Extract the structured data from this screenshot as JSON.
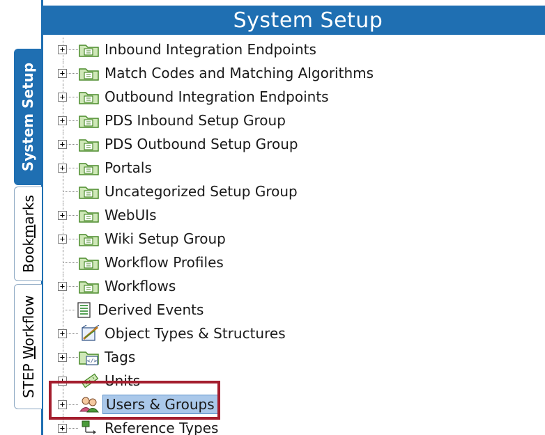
{
  "title": "System Setup",
  "tabs": [
    {
      "label_pre": "System Setup",
      "label_ul": "",
      "label_post": "",
      "active": true
    },
    {
      "label_pre": "Book",
      "label_ul": "m",
      "label_post": "arks",
      "active": false
    },
    {
      "label_pre": "STEP ",
      "label_ul": "W",
      "label_post": "orkflow",
      "active": false
    }
  ],
  "tree": {
    "items": [
      {
        "label": "Inbound Integration Endpoints",
        "icon": "folder-icon",
        "expandable": true
      },
      {
        "label": "Match Codes and Matching Algorithms",
        "icon": "folder-icon",
        "expandable": true
      },
      {
        "label": "Outbound Integration Endpoints",
        "icon": "folder-icon",
        "expandable": true
      },
      {
        "label": "PDS Inbound Setup Group",
        "icon": "folder-icon",
        "expandable": true
      },
      {
        "label": "PDS Outbound Setup Group",
        "icon": "folder-icon",
        "expandable": true
      },
      {
        "label": "Portals",
        "icon": "folder-icon",
        "expandable": true
      },
      {
        "label": "Uncategorized Setup Group",
        "icon": "folder-icon",
        "expandable": false
      },
      {
        "label": "WebUIs",
        "icon": "folder-icon",
        "expandable": true
      },
      {
        "label": "Wiki Setup Group",
        "icon": "folder-icon",
        "expandable": true
      },
      {
        "label": "Workflow Profiles",
        "icon": "folder-icon",
        "expandable": false
      },
      {
        "label": "Workflows",
        "icon": "folder-icon",
        "expandable": true
      },
      {
        "label": "Derived Events",
        "icon": "document-list-icon",
        "expandable": false
      },
      {
        "label": "Object Types & Structures",
        "icon": "object-types-icon",
        "expandable": true
      },
      {
        "label": "Tags",
        "icon": "tags-icon",
        "expandable": true
      },
      {
        "label": "Units",
        "icon": "ruler-icon",
        "expandable": true
      },
      {
        "label": "Users & Groups",
        "icon": "users-groups-icon",
        "expandable": true,
        "selected": true
      },
      {
        "label": "Reference Types",
        "icon": "reference-types-icon",
        "expandable": true
      }
    ]
  },
  "colors": {
    "accent": "#1f6fb2",
    "highlight_border": "#a41e2e",
    "selection": "#aac8ea"
  }
}
